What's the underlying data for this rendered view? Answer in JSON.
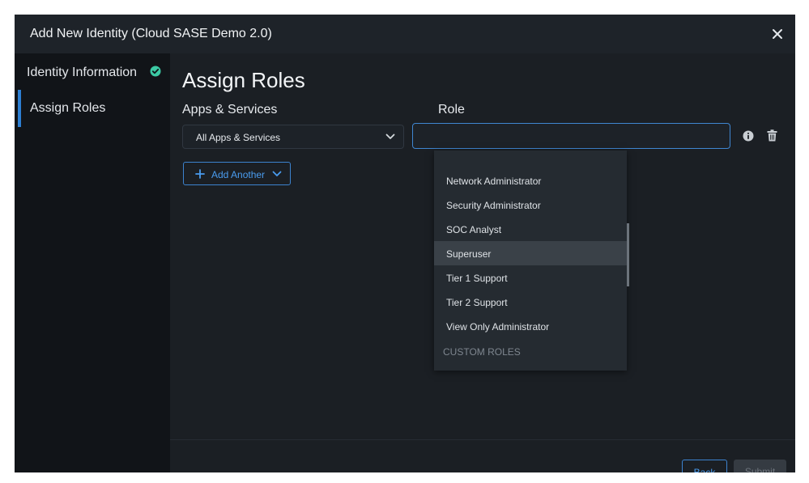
{
  "dialog": {
    "title": "Add New Identity (Cloud SASE Demo 2.0)",
    "close_icon": "close-icon"
  },
  "sidebar": {
    "steps": [
      {
        "label": "Identity Information",
        "status": "complete",
        "icon": "check-circle-icon"
      },
      {
        "label": "Assign Roles",
        "status": "active"
      }
    ]
  },
  "main": {
    "heading": "Assign Roles",
    "apps_label": "Apps & Services",
    "role_label": "Role",
    "apps_select": {
      "value": "All Apps & Services",
      "icon": "chevron-down-icon"
    },
    "role_input": {
      "value": "",
      "placeholder": ""
    },
    "row_icons": [
      "info-icon",
      "trash-icon"
    ],
    "add_another_label": "Add Another"
  },
  "dropdown": {
    "items": [
      "Network Administrator",
      "Security Administrator",
      "SOC Analyst",
      "Superuser",
      "Tier 1 Support",
      "Tier 2 Support",
      "View Only Administrator"
    ],
    "highlighted": "Superuser",
    "group_label": "CUSTOM ROLES"
  },
  "footer": {
    "back_label": "Back",
    "submit_label": "Submit"
  },
  "colors": {
    "accent": "#3c83cf",
    "success": "#3cc9a4",
    "background": "#1b1f24",
    "sidebar": "#111418"
  }
}
